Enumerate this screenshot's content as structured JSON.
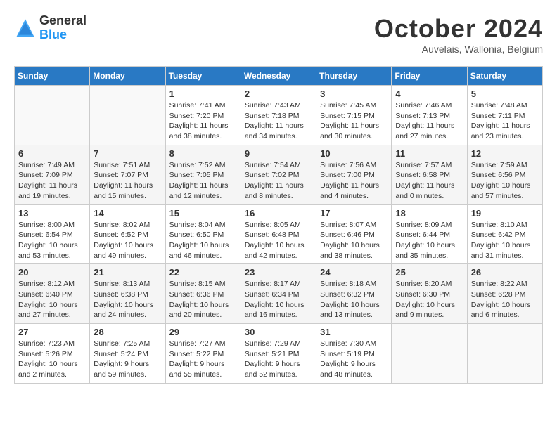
{
  "header": {
    "logo_general": "General",
    "logo_blue": "Blue",
    "month_title": "October 2024",
    "subtitle": "Auvelais, Wallonia, Belgium"
  },
  "weekdays": [
    "Sunday",
    "Monday",
    "Tuesday",
    "Wednesday",
    "Thursday",
    "Friday",
    "Saturday"
  ],
  "weeks": [
    [
      {
        "num": "",
        "info": ""
      },
      {
        "num": "",
        "info": ""
      },
      {
        "num": "1",
        "info": "Sunrise: 7:41 AM\nSunset: 7:20 PM\nDaylight: 11 hours\nand 38 minutes."
      },
      {
        "num": "2",
        "info": "Sunrise: 7:43 AM\nSunset: 7:18 PM\nDaylight: 11 hours\nand 34 minutes."
      },
      {
        "num": "3",
        "info": "Sunrise: 7:45 AM\nSunset: 7:15 PM\nDaylight: 11 hours\nand 30 minutes."
      },
      {
        "num": "4",
        "info": "Sunrise: 7:46 AM\nSunset: 7:13 PM\nDaylight: 11 hours\nand 27 minutes."
      },
      {
        "num": "5",
        "info": "Sunrise: 7:48 AM\nSunset: 7:11 PM\nDaylight: 11 hours\nand 23 minutes."
      }
    ],
    [
      {
        "num": "6",
        "info": "Sunrise: 7:49 AM\nSunset: 7:09 PM\nDaylight: 11 hours\nand 19 minutes."
      },
      {
        "num": "7",
        "info": "Sunrise: 7:51 AM\nSunset: 7:07 PM\nDaylight: 11 hours\nand 15 minutes."
      },
      {
        "num": "8",
        "info": "Sunrise: 7:52 AM\nSunset: 7:05 PM\nDaylight: 11 hours\nand 12 minutes."
      },
      {
        "num": "9",
        "info": "Sunrise: 7:54 AM\nSunset: 7:02 PM\nDaylight: 11 hours\nand 8 minutes."
      },
      {
        "num": "10",
        "info": "Sunrise: 7:56 AM\nSunset: 7:00 PM\nDaylight: 11 hours\nand 4 minutes."
      },
      {
        "num": "11",
        "info": "Sunrise: 7:57 AM\nSunset: 6:58 PM\nDaylight: 11 hours\nand 0 minutes."
      },
      {
        "num": "12",
        "info": "Sunrise: 7:59 AM\nSunset: 6:56 PM\nDaylight: 10 hours\nand 57 minutes."
      }
    ],
    [
      {
        "num": "13",
        "info": "Sunrise: 8:00 AM\nSunset: 6:54 PM\nDaylight: 10 hours\nand 53 minutes."
      },
      {
        "num": "14",
        "info": "Sunrise: 8:02 AM\nSunset: 6:52 PM\nDaylight: 10 hours\nand 49 minutes."
      },
      {
        "num": "15",
        "info": "Sunrise: 8:04 AM\nSunset: 6:50 PM\nDaylight: 10 hours\nand 46 minutes."
      },
      {
        "num": "16",
        "info": "Sunrise: 8:05 AM\nSunset: 6:48 PM\nDaylight: 10 hours\nand 42 minutes."
      },
      {
        "num": "17",
        "info": "Sunrise: 8:07 AM\nSunset: 6:46 PM\nDaylight: 10 hours\nand 38 minutes."
      },
      {
        "num": "18",
        "info": "Sunrise: 8:09 AM\nSunset: 6:44 PM\nDaylight: 10 hours\nand 35 minutes."
      },
      {
        "num": "19",
        "info": "Sunrise: 8:10 AM\nSunset: 6:42 PM\nDaylight: 10 hours\nand 31 minutes."
      }
    ],
    [
      {
        "num": "20",
        "info": "Sunrise: 8:12 AM\nSunset: 6:40 PM\nDaylight: 10 hours\nand 27 minutes."
      },
      {
        "num": "21",
        "info": "Sunrise: 8:13 AM\nSunset: 6:38 PM\nDaylight: 10 hours\nand 24 minutes."
      },
      {
        "num": "22",
        "info": "Sunrise: 8:15 AM\nSunset: 6:36 PM\nDaylight: 10 hours\nand 20 minutes."
      },
      {
        "num": "23",
        "info": "Sunrise: 8:17 AM\nSunset: 6:34 PM\nDaylight: 10 hours\nand 16 minutes."
      },
      {
        "num": "24",
        "info": "Sunrise: 8:18 AM\nSunset: 6:32 PM\nDaylight: 10 hours\nand 13 minutes."
      },
      {
        "num": "25",
        "info": "Sunrise: 8:20 AM\nSunset: 6:30 PM\nDaylight: 10 hours\nand 9 minutes."
      },
      {
        "num": "26",
        "info": "Sunrise: 8:22 AM\nSunset: 6:28 PM\nDaylight: 10 hours\nand 6 minutes."
      }
    ],
    [
      {
        "num": "27",
        "info": "Sunrise: 7:23 AM\nSunset: 5:26 PM\nDaylight: 10 hours\nand 2 minutes."
      },
      {
        "num": "28",
        "info": "Sunrise: 7:25 AM\nSunset: 5:24 PM\nDaylight: 9 hours\nand 59 minutes."
      },
      {
        "num": "29",
        "info": "Sunrise: 7:27 AM\nSunset: 5:22 PM\nDaylight: 9 hours\nand 55 minutes."
      },
      {
        "num": "30",
        "info": "Sunrise: 7:29 AM\nSunset: 5:21 PM\nDaylight: 9 hours\nand 52 minutes."
      },
      {
        "num": "31",
        "info": "Sunrise: 7:30 AM\nSunset: 5:19 PM\nDaylight: 9 hours\nand 48 minutes."
      },
      {
        "num": "",
        "info": ""
      },
      {
        "num": "",
        "info": ""
      }
    ]
  ]
}
